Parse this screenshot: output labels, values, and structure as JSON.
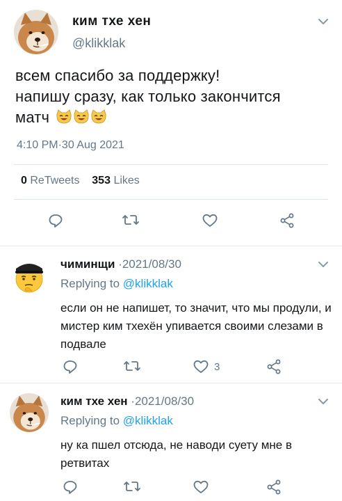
{
  "main_tweet": {
    "author_name": "ким тхе хен",
    "handle": "@klikklak",
    "text_line1": "всем спасибо за поддержку!",
    "text_line2": "напишу сразу, как только закончится",
    "text_line3": "матч",
    "emoji": "😼😼😼",
    "timestamp": "4:10 PM·30 Aug 2021",
    "retweets_count": "0",
    "retweets_label": "ReTweets",
    "likes_count": "353",
    "likes_label": "Likes"
  },
  "replies": [
    {
      "author_name": "чиминщи",
      "date": "·2021/08/30",
      "replying_prefix": "Replying to",
      "replying_handle": "@klikklak",
      "text": "если он не напишет, то значит, что мы продули, и мистер ким тхехён упивается своими слезами в подвале",
      "likes_count": "3"
    },
    {
      "author_name": "ким тхе хен",
      "date": "·2021/08/30",
      "replying_prefix": "Replying to",
      "replying_handle": "@klikklak",
      "text": "ну ка пшел отсюда, не наводи суету мне в ретвитах",
      "likes_count": ""
    }
  ],
  "colors": {
    "text": "#14171a",
    "secondary": "#657786",
    "link": "#1da1f2",
    "divider": "#e1e8ed"
  }
}
